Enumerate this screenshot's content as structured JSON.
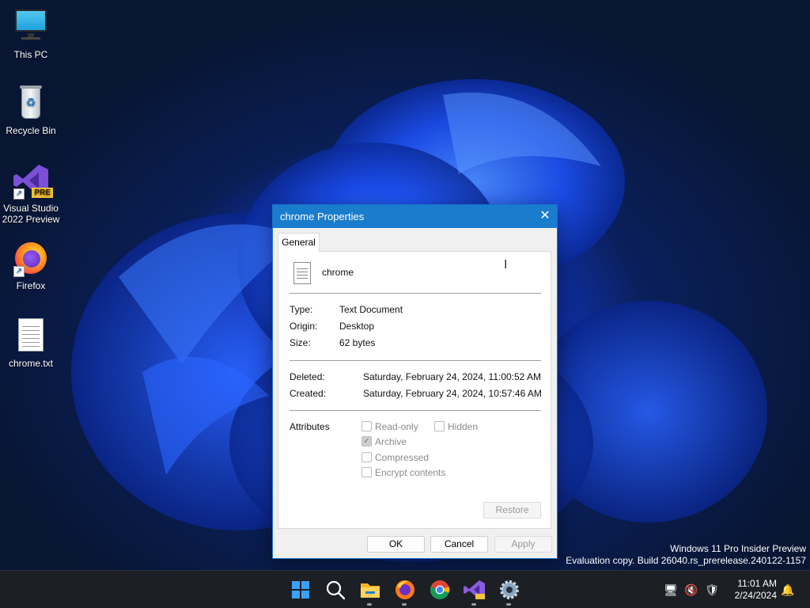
{
  "desktop": {
    "icons": [
      {
        "label": "This PC",
        "icon": "monitor-icon"
      },
      {
        "label": "Recycle Bin",
        "icon": "recycle-bin-icon"
      },
      {
        "label": "Visual Studio\n2022 Preview",
        "line1": "Visual Studio",
        "line2": "2022 Preview",
        "icon": "visual-studio-icon",
        "badge": "PRE"
      },
      {
        "label": "Firefox",
        "icon": "firefox-icon"
      },
      {
        "label": "chrome.txt",
        "icon": "text-file-icon"
      }
    ],
    "watermark": {
      "line1": "Windows 11 Pro Insider Preview",
      "line2": "Evaluation copy. Build 26040.rs_prerelease.240122-1157"
    }
  },
  "dialog": {
    "title": "chrome Properties",
    "tab": "General",
    "file_name": "chrome",
    "type_label": "Type:",
    "type_value": "Text Document",
    "origin_label": "Origin:",
    "origin_value": "Desktop",
    "size_label": "Size:",
    "size_value": "62 bytes",
    "deleted_label": "Deleted:",
    "deleted_value": "Saturday, February 24, 2024, 11:00:52 AM",
    "created_label": "Created:",
    "created_value": "Saturday, February 24, 2024, 10:57:46 AM",
    "attributes_label": "Attributes",
    "attributes": {
      "readonly": {
        "label": "Read-only",
        "checked": false
      },
      "hidden": {
        "label": "Hidden",
        "checked": false
      },
      "archive": {
        "label": "Archive",
        "checked": true
      },
      "compressed": {
        "label": "Compressed",
        "checked": false
      },
      "encrypt": {
        "label": "Encrypt contents",
        "checked": false
      }
    },
    "restore_label": "Restore",
    "ok_label": "OK",
    "cancel_label": "Cancel",
    "apply_label": "Apply"
  },
  "taskbar": {
    "time": "11:01 AM",
    "date": "2/24/2024",
    "apps": [
      "start-icon",
      "search-icon",
      "file-explorer-icon",
      "firefox-icon",
      "chrome-icon",
      "visual-studio-icon",
      "settings-icon"
    ]
  },
  "colors": {
    "accent": "#1a7ccd",
    "taskbar": "#1c1f24"
  }
}
